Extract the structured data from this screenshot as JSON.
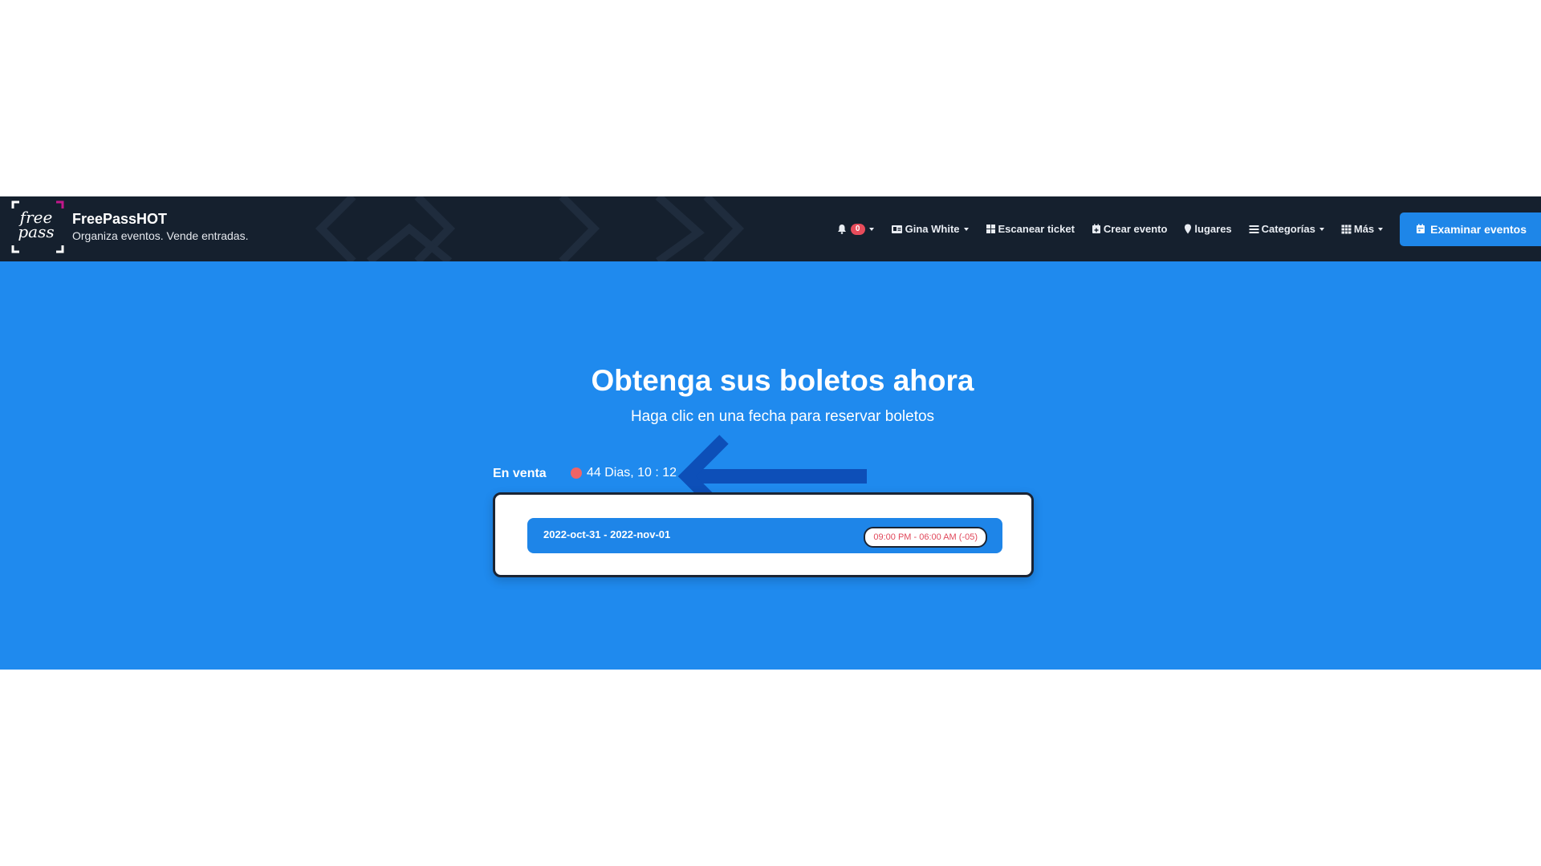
{
  "brand": {
    "name": "FreePassHOT",
    "tagline": "Organiza eventos. Vende entradas.",
    "logo_text_line1": "free",
    "logo_text_line2": "pass"
  },
  "nav": {
    "notifications_count": "0",
    "user_name": "Gina White",
    "scan_ticket": "Escanear ticket",
    "create_event": "Crear evento",
    "venues": "lugares",
    "categories": "Categorías",
    "more": "Más",
    "browse_events": "Examinar eventos"
  },
  "hero": {
    "title": "Obtenga sus boletos ahora",
    "subtitle": "Haga clic en una fecha para reservar boletos"
  },
  "sale": {
    "label": "En venta",
    "countdown": "44 Dias, 10 : 12"
  },
  "event_dates": [
    {
      "range": "2022-oct-31 - 2022-nov-01",
      "time": "09:00 PM - 06:00 AM (-05)"
    }
  ],
  "colors": {
    "navbar": "#15202e",
    "hero": "#1f8aee",
    "accent": "#1e86e8",
    "badge": "#e74c5b",
    "arrow": "#0d4fb8"
  },
  "icons": {
    "notifications": "bell-icon",
    "user": "id-card-icon",
    "scan": "grid-icon",
    "create": "calendar-plus-icon",
    "venues": "map-marker-icon",
    "categories": "list-icon",
    "more": "apps-icon",
    "browse": "calendar-icon",
    "annotation": "left-arrow-annotation"
  }
}
